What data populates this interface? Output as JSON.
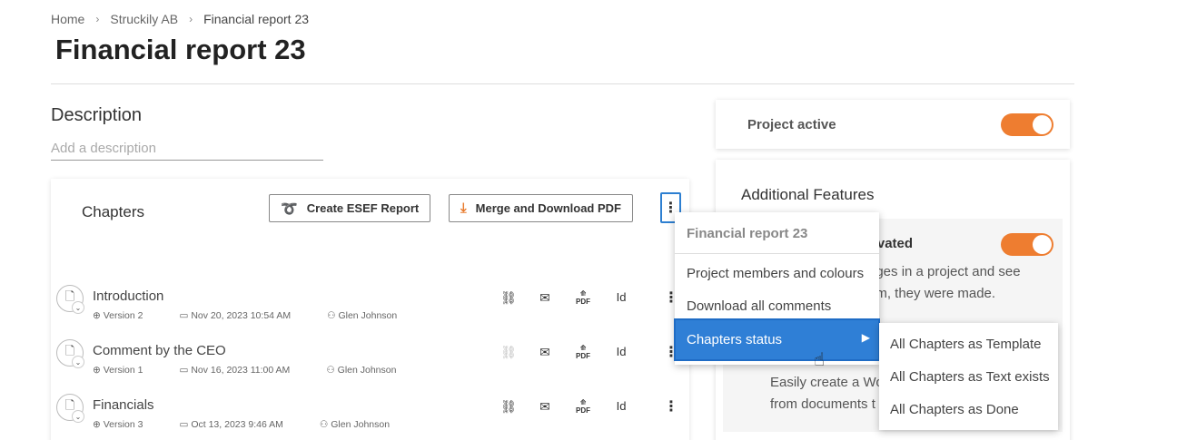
{
  "breadcrumb": {
    "items": [
      "Home",
      "Struckily AB",
      "Financial report 23"
    ]
  },
  "page_title": "Financial report 23",
  "description": {
    "heading": "Description",
    "placeholder": "Add a description",
    "value": ""
  },
  "chapters": {
    "title": "Chapters",
    "esef_button": "Create ESEF Report",
    "merge_button": "Merge and Download PDF",
    "rows": [
      {
        "title": "Introduction",
        "version": "Version 2",
        "date": "Nov 20, 2023 10:54 AM",
        "user": "Glen Johnson",
        "link_active": true
      },
      {
        "title": "Comment by the CEO",
        "version": "Version 1",
        "date": "Nov 16, 2023 11:00 AM",
        "user": "Glen Johnson",
        "link_active": false
      },
      {
        "title": "Financials",
        "version": "Version 3",
        "date": "Oct 13, 2023 9:46 AM",
        "user": "Glen Johnson",
        "link_active": true
      }
    ],
    "pdf_icon_label": "PDF",
    "id_label": "Id"
  },
  "right_panel": {
    "project_active_label": "Project active",
    "project_active_on": true,
    "additional_features_title": "Additional Features",
    "feature_title_visible": "activated",
    "feature_text_line1": "nges in a project and see",
    "feature_text_line2": "om, they were made.",
    "feature2_line1": "Easily create a Wo",
    "feature2_line2": "from documents t",
    "feature_on": true
  },
  "dropdown": {
    "header": "Financial report 23",
    "items": [
      "Project members and colours",
      "Download all comments"
    ],
    "selected": "Chapters status",
    "submenu": [
      "All Chapters as Template",
      "All Chapters as Text exists",
      "All Chapters as Done"
    ]
  },
  "colors": {
    "accent": "#ee7d30",
    "selection": "#2f7fd6"
  }
}
